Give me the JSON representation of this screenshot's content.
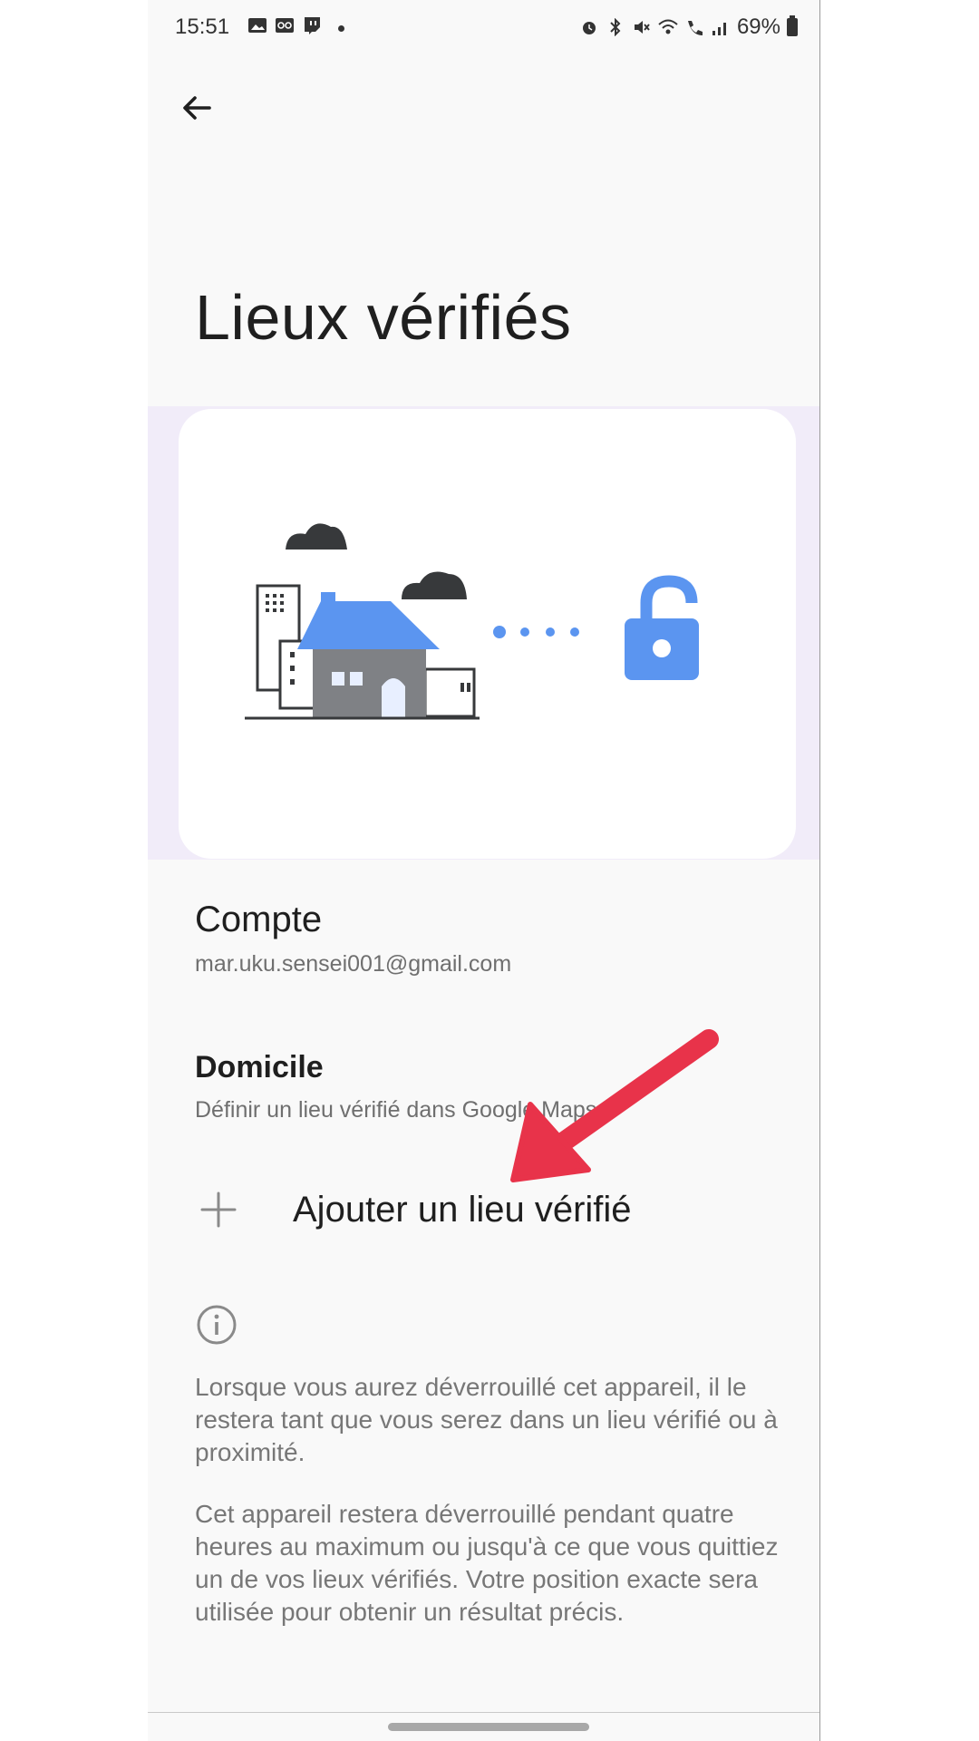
{
  "status_bar": {
    "time": "15:51",
    "battery": "69%",
    "left_icons": [
      "gallery-icon",
      "voicemail-icon",
      "twitch-icon",
      "dot-icon"
    ],
    "right_icons": [
      "alarm-icon",
      "bluetooth-icon",
      "mute-icon",
      "wifi-icon",
      "call-icon",
      "signal-icon",
      "battery-icon"
    ]
  },
  "header": {
    "back_icon": "back-arrow-icon",
    "title": "Lieux vérifiés"
  },
  "account": {
    "title": "Compte",
    "email": "mar.uku.sensei001@gmail.com"
  },
  "home": {
    "title": "Domicile",
    "subtitle": "Définir un lieu vérifié dans Google Maps"
  },
  "add_place": {
    "icon": "plus-icon",
    "label": "Ajouter un lieu vérifié"
  },
  "info": {
    "icon": "info-icon",
    "paragraph1": "Lorsque vous aurez déverrouillé cet appareil, il le restera tant que vous serez dans un lieu vérifié ou à proximité.",
    "paragraph2": "Cet appareil restera déverrouillé pendant quatre heures au maximum ou jusqu'à ce que vous quittiez un de vos lieux vérifiés. Votre position exacte sera utilisée pour obtenir un résultat précis."
  },
  "colors": {
    "accent_blue": "#5b95f0",
    "arrow_red": "#e8334a",
    "hero_band": "#f1ecf9"
  }
}
